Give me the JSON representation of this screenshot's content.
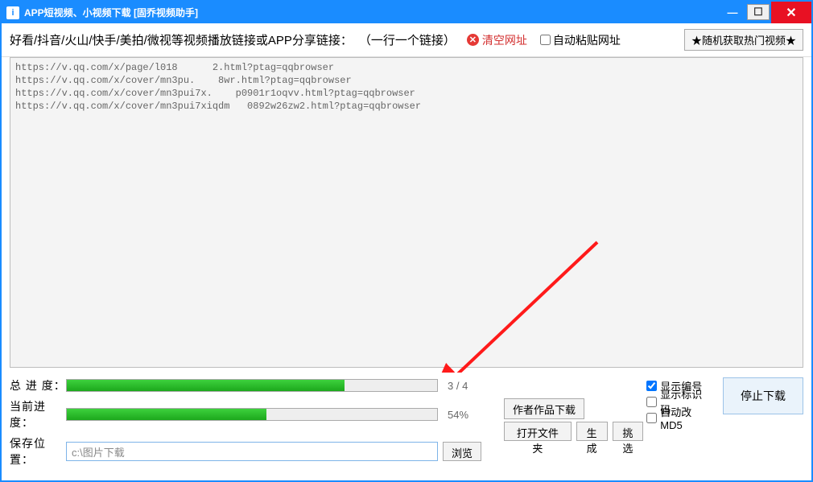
{
  "titlebar": {
    "title": "APP短视频、小视频下载 [固乔视频助手]"
  },
  "toolbar": {
    "instruction": "好看/抖音/火山/快手/美拍/微视等视频播放链接或APP分享链接：",
    "per_line": "（一行一个链接）",
    "clear_label": "清空网址",
    "auto_paste_label": "自动粘贴网址",
    "hot_button": "★随机获取热门视频★"
  },
  "urls": [
    "https://v.qq.com/x/page/l018      2.html?ptag=qqbrowser",
    "https://v.qq.com/x/cover/mn3pu.    8wr.html?ptag=qqbrowser",
    "https://v.qq.com/x/cover/mn3pui7x.    p0901r1oqvv.html?ptag=qqbrowser",
    "https://v.qq.com/x/cover/mn3pui7xiqdm   0892w26zw2.html?ptag=qqbrowser"
  ],
  "progress": {
    "total_label": "总 进 度：",
    "total_pct": 75,
    "total_text": "3 / 4",
    "current_label": "当前进度：",
    "current_pct": 54,
    "current_text": "54%"
  },
  "save": {
    "label": "保存位置：",
    "path": "c:\\图片下载",
    "browse": "浏览",
    "open_folder": "打开文件夹",
    "generate": "生成",
    "pick": "挑选"
  },
  "actions": {
    "author_works": "作者作品下载",
    "stop": "停止下载"
  },
  "options": {
    "show_number": "显示编号",
    "show_id_code": "显示标识码",
    "auto_md5": "自动改MD5"
  }
}
